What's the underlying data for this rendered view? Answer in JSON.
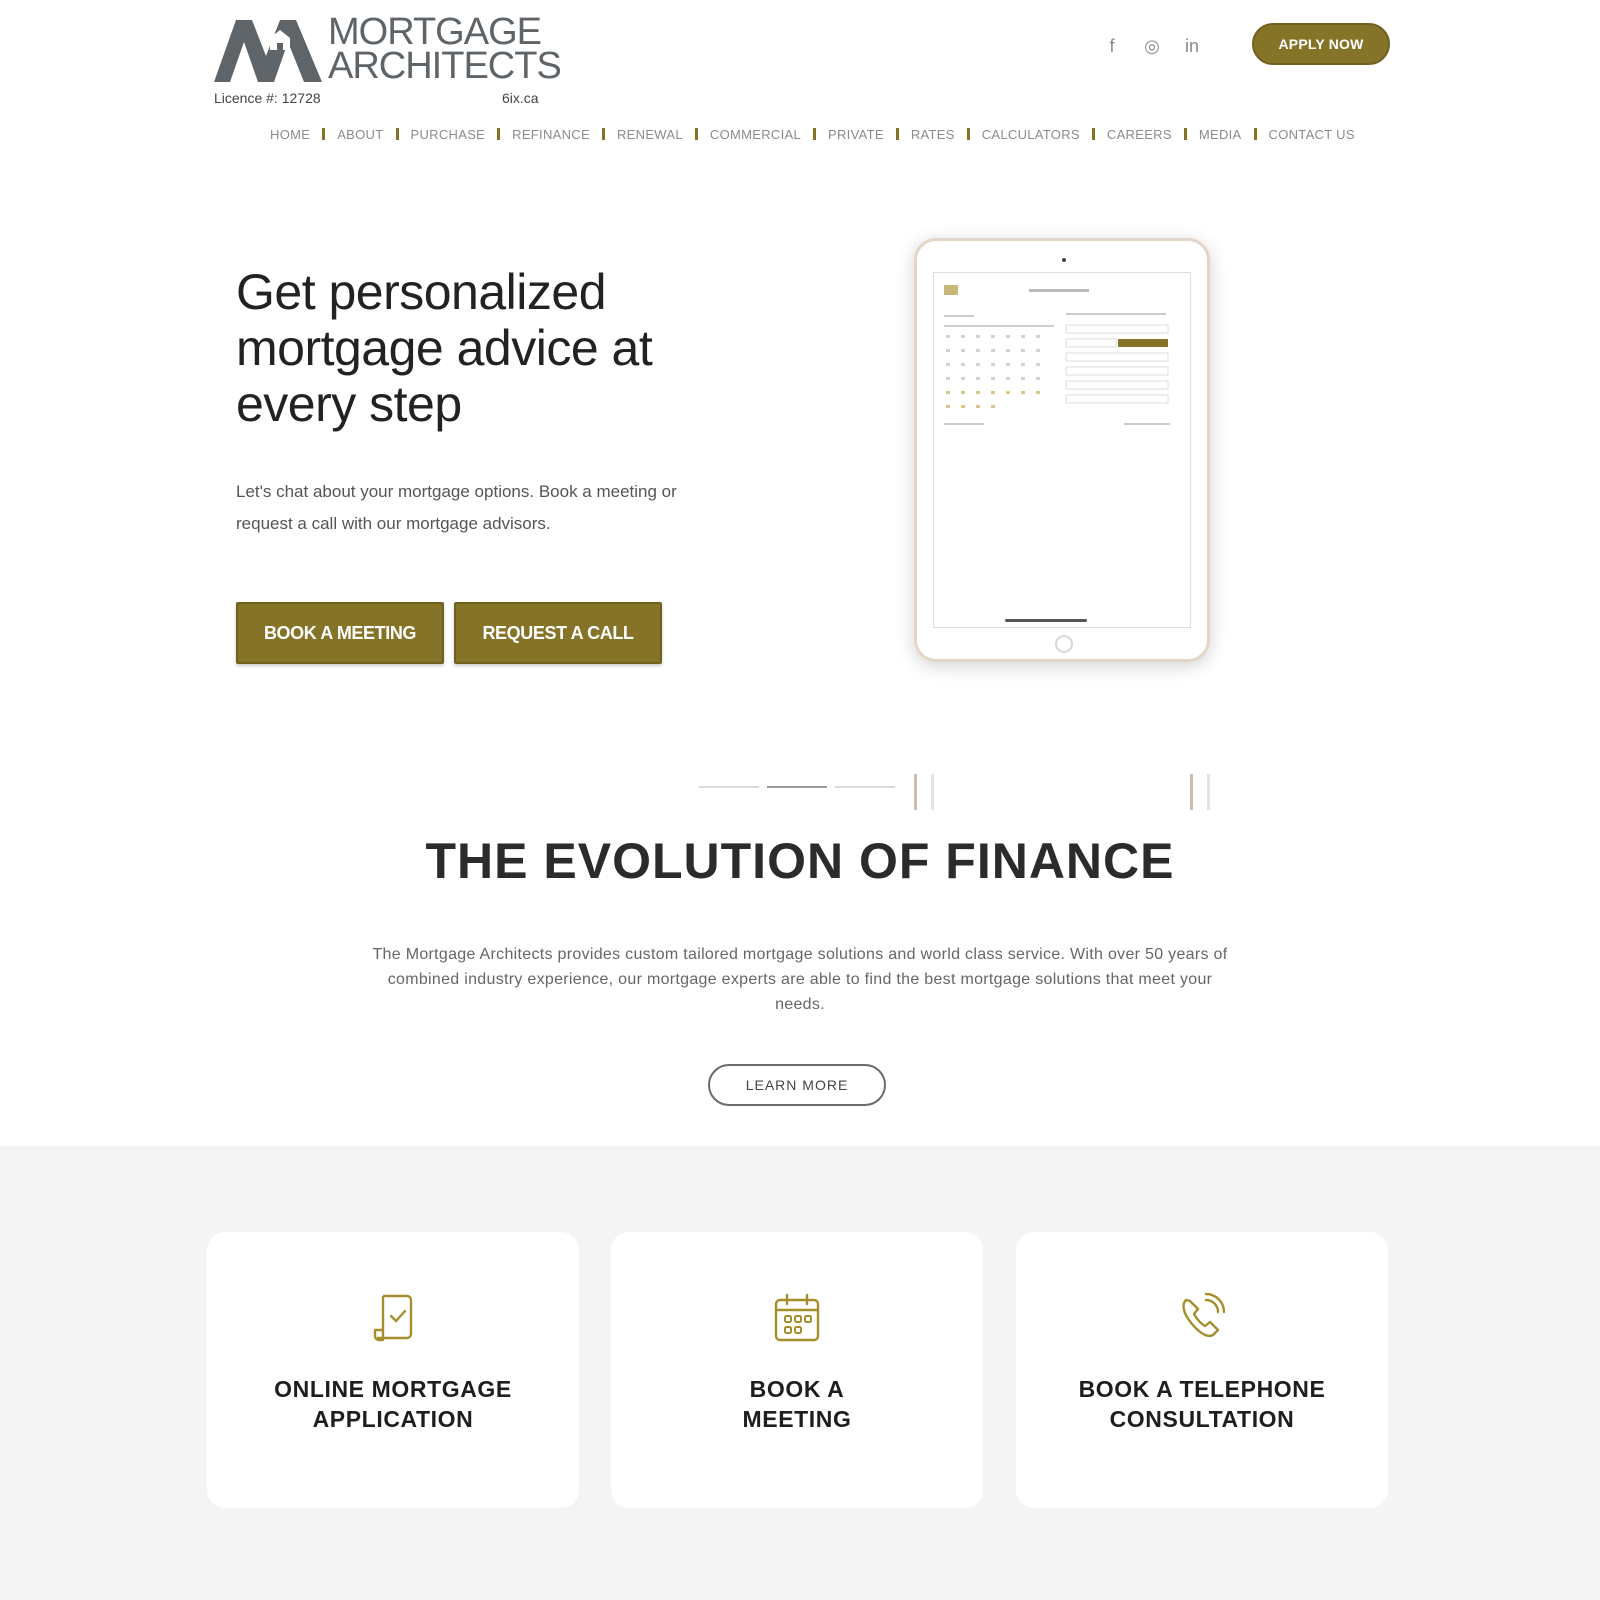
{
  "brand": {
    "wordmark_line1": "MORTGAGE",
    "wordmark_line2": "ARCHITECTS",
    "licence": "Licence #: 12728",
    "site": "6ix.ca"
  },
  "social": {
    "facebook": "f",
    "instagram": "◎",
    "linkedin": "in"
  },
  "header": {
    "apply_label": "APPLY NOW"
  },
  "nav": {
    "items": [
      "HOME",
      "ABOUT",
      "PURCHASE",
      "REFINANCE",
      "RENEWAL",
      "COMMERCIAL",
      "PRIVATE",
      "RATES",
      "CALCULATORS",
      "CAREERS",
      "MEDIA",
      "CONTACT US"
    ]
  },
  "hero": {
    "title": "Get personalized mortgage advice at every step",
    "subtitle": "Let's chat about your mortgage options. Book a meeting or request a call with our mortgage advisors.",
    "book_label": "BOOK A MEETING",
    "call_label": "REQUEST A CALL"
  },
  "evolution": {
    "title": "THE EVOLUTION OF FINANCE",
    "text": "The Mortgage Architects provides custom tailored mortgage solutions and world class service. With over 50 years of combined industry experience, our mortgage experts are able to find the best mortgage solutions that meet your needs.",
    "learn_label": "LEARN MORE"
  },
  "cards": [
    {
      "label": "ONLINE MORTGAGE\nAPPLICATION",
      "icon": "document-check-icon"
    },
    {
      "label": "BOOK A\nMEETING",
      "icon": "calendar-icon"
    },
    {
      "label": "BOOK A TELEPHONE\nCONSULTATION",
      "icon": "phone-icon"
    }
  ],
  "colors": {
    "accent": "#857427",
    "logo_gray": "#5e6468",
    "band": "#f4f4f4"
  }
}
